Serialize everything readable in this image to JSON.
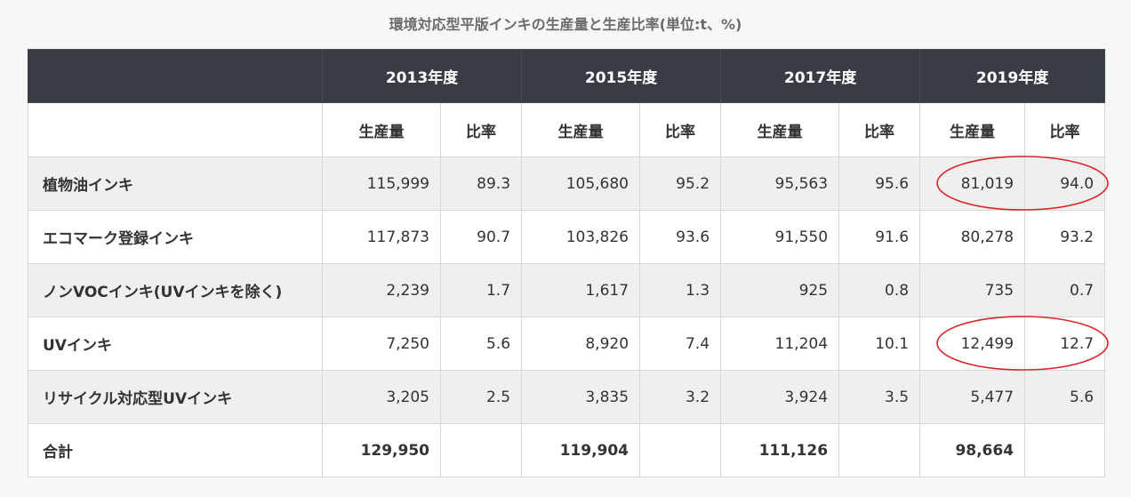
{
  "caption": "環境対応型平版インキの生産量と生産比率(単位:t、%)",
  "years": [
    "2013年度",
    "2015年度",
    "2017年度",
    "2019年度"
  ],
  "sub_headers": {
    "qty": "生産量",
    "ratio": "比率"
  },
  "rows": [
    {
      "label": "植物油インキ",
      "cells": [
        "115,999",
        "89.3",
        "105,680",
        "95.2",
        "95,563",
        "95.6",
        "81,019",
        "94.0"
      ]
    },
    {
      "label": "エコマーク登録インキ",
      "cells": [
        "117,873",
        "90.7",
        "103,826",
        "93.6",
        "91,550",
        "91.6",
        "80,278",
        "93.2"
      ]
    },
    {
      "label": "ノンVOCインキ(UVインキを除く)",
      "cells": [
        "2,239",
        "1.7",
        "1,617",
        "1.3",
        "925",
        "0.8",
        "735",
        "0.7"
      ]
    },
    {
      "label": "UVインキ",
      "cells": [
        "7,250",
        "5.6",
        "8,920",
        "7.4",
        "11,204",
        "10.1",
        "12,499",
        "12.7"
      ]
    },
    {
      "label": "リサイクル対応型UVインキ",
      "cells": [
        "3,205",
        "2.5",
        "3,835",
        "3.2",
        "3,924",
        "3.5",
        "5,477",
        "5.6"
      ]
    },
    {
      "label": "合計",
      "cells": [
        "129,950",
        "",
        "119,904",
        "",
        "111,126",
        "",
        "98,664",
        ""
      ]
    }
  ],
  "highlight_color": "#d9252a"
}
